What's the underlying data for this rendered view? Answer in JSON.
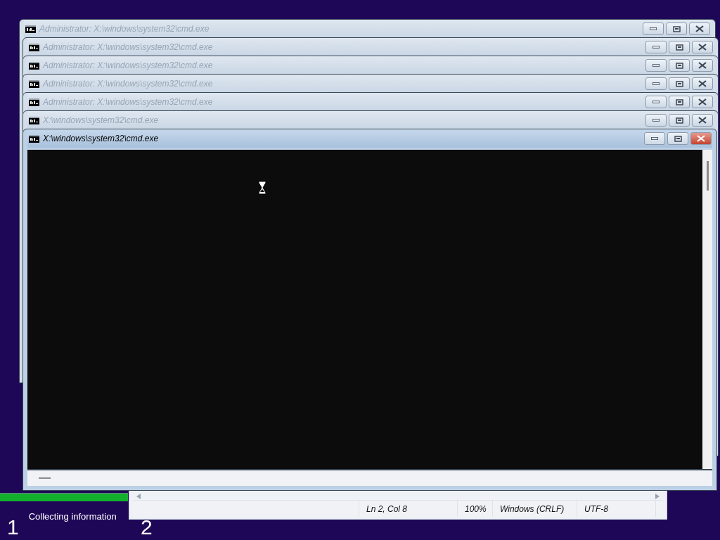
{
  "background_windows": [
    {
      "title": "Administrator: X:\\windows\\system32\\cmd.exe",
      "active": false
    },
    {
      "title": "Administrator: X:\\windows\\system32\\cmd.exe",
      "active": false
    },
    {
      "title": "Administrator: X:\\windows\\system32\\cmd.exe",
      "active": false
    },
    {
      "title": "Administrator: X:\\windows\\system32\\cmd.exe",
      "active": false
    },
    {
      "title": "Administrator: X:\\windows\\system32\\cmd.exe",
      "active": false
    },
    {
      "title": "X:\\windows\\system32\\cmd.exe",
      "active": false
    }
  ],
  "front_window": {
    "title": "X:\\windows\\system32\\cmd.exe",
    "active": true
  },
  "notepad_status_bar": [
    "Ln 2, Col 8",
    "100%",
    "Windows (CRLF)",
    "UTF-8"
  ],
  "setup_steps": [
    {
      "number": "1",
      "label": "Collecting information",
      "level": 1
    },
    {
      "number": "2"
    }
  ]
}
